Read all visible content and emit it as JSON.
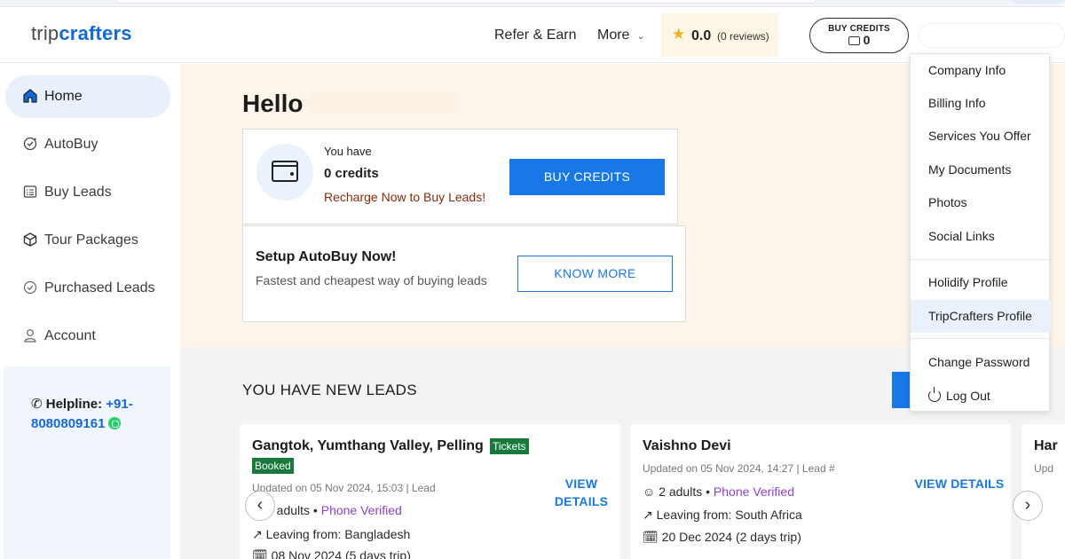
{
  "header": {
    "logo_trip": "trip",
    "logo_crafters": "crafters",
    "refer_earn": "Refer & Earn",
    "more": "More",
    "rating": "0.0",
    "reviews": "(0 reviews)",
    "buy_credits_label": "BUY CREDITS",
    "credits_count": "0"
  },
  "sidebar": {
    "items": [
      {
        "label": "Home",
        "icon": "home-icon",
        "active": true
      },
      {
        "label": "AutoBuy",
        "icon": "autobuy-icon"
      },
      {
        "label": "Buy Leads",
        "icon": "list-icon"
      },
      {
        "label": "Tour Packages",
        "icon": "package-icon"
      },
      {
        "label": "Purchased Leads",
        "icon": "check-circle-icon"
      },
      {
        "label": "Account",
        "icon": "user-icon"
      }
    ],
    "helpline_label": "Helpline:",
    "helpline_number": "+91-8080809161"
  },
  "main": {
    "hello": "Hello",
    "credits_card": {
      "you_have": "You have",
      "amount": "0 credits",
      "recharge": "Recharge Now to Buy Leads!",
      "button": "BUY CREDITS"
    },
    "autobuy_card": {
      "title": "Setup AutoBuy Now!",
      "subtitle": "Fastest and cheapest way of buying leads",
      "button": "KNOW MORE"
    },
    "leads_heading": "YOU HAVE NEW LEADS",
    "leads": [
      {
        "title": "Gangtok, Yumthang Valley, Pelling",
        "badge": "Tickets",
        "badge2": "Booked",
        "updated": "Updated on 05 Nov 2024, 15:03 | Lead",
        "adults": "2 adults",
        "verified": "Phone Verified",
        "leaving": "Leaving from: Bangladesh",
        "date": "08 Nov 2024 (5 days trip)",
        "view": "VIEW DETAILS"
      },
      {
        "title": "Vaishno Devi",
        "updated": "Updated on 05 Nov 2024, 14:27 | Lead #",
        "adults": "2 adults",
        "verified": "Phone Verified",
        "leaving": "Leaving from: South Africa",
        "date": "20 Dec 2024 (2 days trip)",
        "view": "VIEW DETAILS"
      },
      {
        "title": "Har",
        "updated": "Upd"
      }
    ]
  },
  "dropdown": {
    "items": [
      "Company Info",
      "Billing Info",
      "Services You Offer",
      "My Documents",
      "Photos",
      "Social Links",
      "Holidify Profile",
      "TripCrafters Profile",
      "Change Password",
      "Log Out"
    ]
  },
  "colors": {
    "brand_blue": "#1778e6",
    "logo_blue": "#1468d8",
    "recharge_text": "#8a2a07",
    "badge_green": "#177a3c",
    "verified_purple": "#8f3fcf",
    "hero_bg": "#fdf5ea"
  }
}
